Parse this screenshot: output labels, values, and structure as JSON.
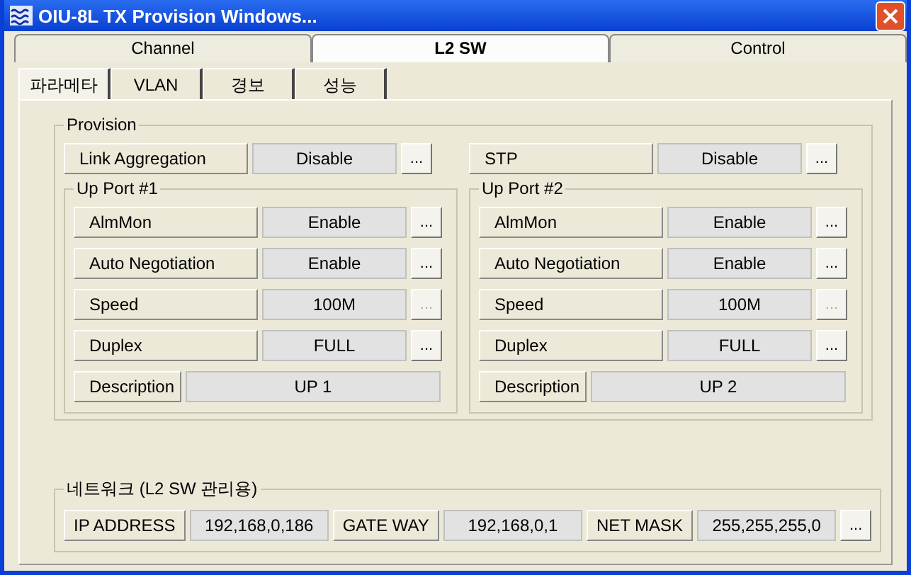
{
  "window": {
    "title": "OIU-8L TX Provision Windows..."
  },
  "tabs": [
    {
      "label": "Channel",
      "selected": false
    },
    {
      "label": "L2 SW",
      "selected": true
    },
    {
      "label": "Control",
      "selected": false
    }
  ],
  "subtabs": [
    {
      "label": "파라메타",
      "selected": true
    },
    {
      "label": "VLAN",
      "selected": false
    },
    {
      "label": "경보",
      "selected": false
    },
    {
      "label": "성능",
      "selected": false
    }
  ],
  "provision": {
    "title": "Provision",
    "settings": [
      {
        "label": "Link Aggregation",
        "value": "Disable",
        "button": "...",
        "disabled": false
      },
      {
        "label": "STP",
        "value": "Disable",
        "button": "...",
        "disabled": false
      }
    ],
    "ports": [
      {
        "title": "Up Port #1",
        "rows": [
          {
            "kind": "select",
            "label": "AlmMon",
            "value": "Enable",
            "button": "...",
            "disabled": false
          },
          {
            "kind": "select",
            "label": "Auto Negotiation",
            "value": "Enable",
            "button": "...",
            "disabled": false
          },
          {
            "kind": "select",
            "label": "Speed",
            "value": "100M",
            "button": "...",
            "disabled": true
          },
          {
            "kind": "select",
            "label": "Duplex",
            "value": "FULL",
            "button": "...",
            "disabled": false
          },
          {
            "kind": "text",
            "label": "Description",
            "value": "UP 1"
          }
        ]
      },
      {
        "title": "Up Port #2",
        "rows": [
          {
            "kind": "select",
            "label": "AlmMon",
            "value": "Enable",
            "button": "...",
            "disabled": false
          },
          {
            "kind": "select",
            "label": "Auto Negotiation",
            "value": "Enable",
            "button": "...",
            "disabled": false
          },
          {
            "kind": "select",
            "label": "Speed",
            "value": "100M",
            "button": "...",
            "disabled": true
          },
          {
            "kind": "select",
            "label": "Duplex",
            "value": "FULL",
            "button": "...",
            "disabled": false
          },
          {
            "kind": "text",
            "label": "Description",
            "value": "UP 2"
          }
        ]
      }
    ]
  },
  "network": {
    "title": "네트워크 (L2 SW 관리용)",
    "fields": [
      {
        "label": "IP ADDRESS",
        "value": "192,168,0,186"
      },
      {
        "label": "GATE WAY",
        "value": "192,168,0,1"
      },
      {
        "label": "NET MASK",
        "value": "255,255,255,0"
      }
    ],
    "button": "..."
  }
}
